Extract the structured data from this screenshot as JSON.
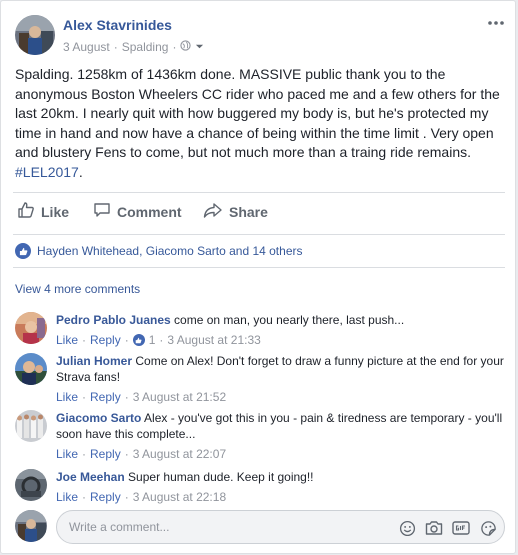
{
  "post": {
    "author": "Alex Stavrinides",
    "date": "3 August",
    "location": "Spalding",
    "text_main": "Spalding. 1258km of 1436km done. MASSIVE public thank you to the anonymous Boston Wheelers CC rider who paced me and a few others for the last 20km. I nearly quit with how buggered my body is, but he's protected my time in hand and now have a chance of being within the time limit . Very open and blustery Fens to come, but not much more than a traing ride remains.",
    "hashtag": "#LEL2017",
    "text_end": "."
  },
  "actions": {
    "like": "Like",
    "comment": "Comment",
    "share": "Share"
  },
  "reactions": {
    "summary": "Hayden Whitehead, Giacomo Sarto and 14 others"
  },
  "comments_section": {
    "view_more": "View 4 more comments",
    "like_label": "Like",
    "reply_label": "Reply",
    "sep": "·",
    "write_placeholder": "Write a comment..."
  },
  "comments": [
    {
      "name": "Pedro Pablo Juanes",
      "text": "come on man, you nearly there, last push...",
      "likes": "1",
      "time": "3 August at 21:33"
    },
    {
      "name": "Julian Homer",
      "text": "Come on Alex! Don't forget to draw a funny picture at the end for your Strava fans!",
      "time": "3 August at 21:52"
    },
    {
      "name": "Giacomo Sarto",
      "text": "Alex - you've got this in you - pain & tiredness are temporary - you'll soon have this complete...",
      "time": "3 August at 22:07"
    },
    {
      "name": "Joe Meehan",
      "text": "Super human dude. Keep it going!!",
      "time": "3 August at 22:18"
    }
  ],
  "colors": {
    "link": "#365899",
    "accent": "#4267b2",
    "muted": "#90949c"
  }
}
